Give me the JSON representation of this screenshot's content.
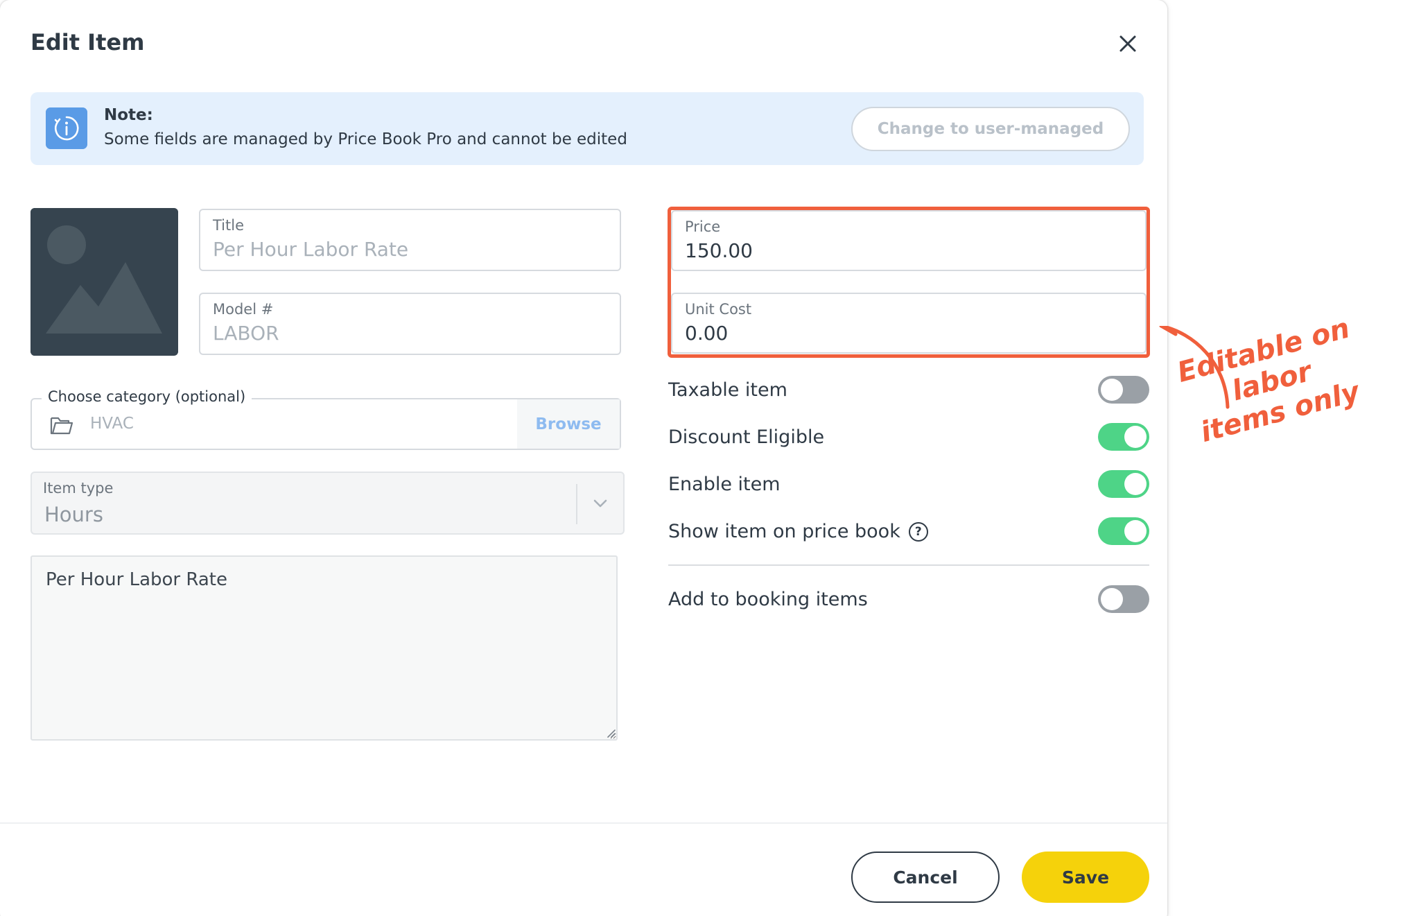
{
  "dialog": {
    "title": "Edit Item"
  },
  "note": {
    "heading": "Note:",
    "text": "Some fields are managed by Price Book Pro and cannot be edited",
    "change_button": "Change to user-managed"
  },
  "fields": {
    "title": {
      "label": "Title",
      "value": "Per Hour Labor Rate"
    },
    "model": {
      "label": "Model #",
      "value": "LABOR"
    },
    "price": {
      "label": "Price",
      "value": "150.00"
    },
    "unit_cost": {
      "label": "Unit Cost",
      "value": "0.00"
    }
  },
  "category": {
    "legend": "Choose category (optional)",
    "value": "HVAC",
    "browse": "Browse"
  },
  "item_type": {
    "label": "Item type",
    "value": "Hours"
  },
  "description": {
    "value": "Per Hour Labor Rate"
  },
  "toggles": [
    {
      "label": "Taxable item",
      "state": "off"
    },
    {
      "label": "Discount Eligible",
      "state": "on"
    },
    {
      "label": "Enable item",
      "state": "on"
    },
    {
      "label": "Show item on price book",
      "state": "on",
      "help": "?"
    },
    {
      "label": "Add to booking items",
      "state": "off"
    }
  ],
  "footer": {
    "cancel": "Cancel",
    "save": "Save"
  },
  "annotation": {
    "line1": "Editable on labor",
    "line2": "items only"
  },
  "colors": {
    "accent_orange": "#f05f3c",
    "toggle_on": "#4ed487",
    "toggle_off": "#9aa0a6",
    "save_yellow": "#f5d20b",
    "note_bg": "#e4f0fd",
    "info_icon": "#5a9be6"
  }
}
